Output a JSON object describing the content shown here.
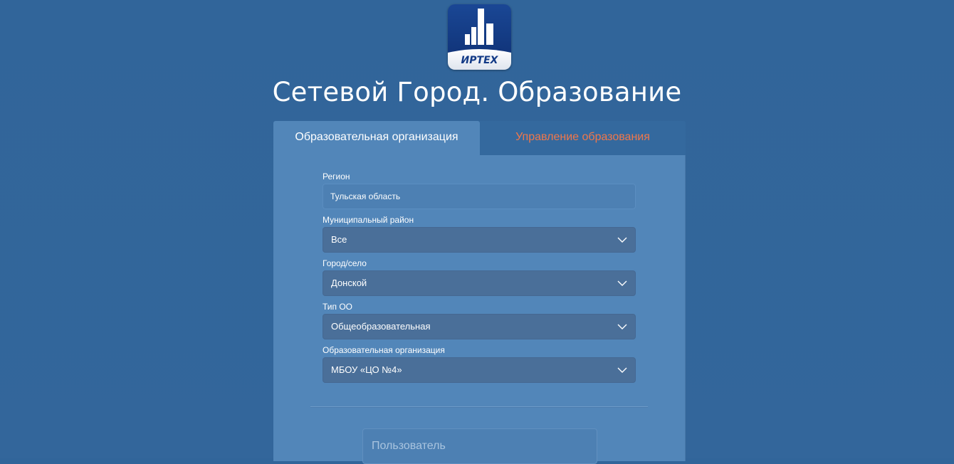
{
  "logo": {
    "text": "ИРТЕХ",
    "icon": "buildings-icon",
    "colors": {
      "top": "#123a86",
      "bottom": "#ffffff"
    }
  },
  "app_title": "Сетевой Город. Образование",
  "tabs": [
    {
      "label": "Образовательная организация",
      "active": true
    },
    {
      "label": "Управление образования",
      "active": false
    }
  ],
  "form": {
    "region": {
      "label": "Регион",
      "value": "Тульская область"
    },
    "district": {
      "label": "Муниципальный район",
      "value": "Все"
    },
    "city": {
      "label": "Город/село",
      "value": "Донской"
    },
    "org_type": {
      "label": "Тип ОО",
      "value": "Общеобразовательная"
    },
    "organization": {
      "label": "Образовательная организация",
      "value": "МБОУ «ЦО №4»"
    },
    "username": {
      "placeholder": "Пользователь",
      "value": ""
    }
  },
  "colors": {
    "background": "#336699",
    "panel": "#5286b9",
    "inactive_tab_text": "#f0774a",
    "select_bg": "#4a6f99"
  }
}
